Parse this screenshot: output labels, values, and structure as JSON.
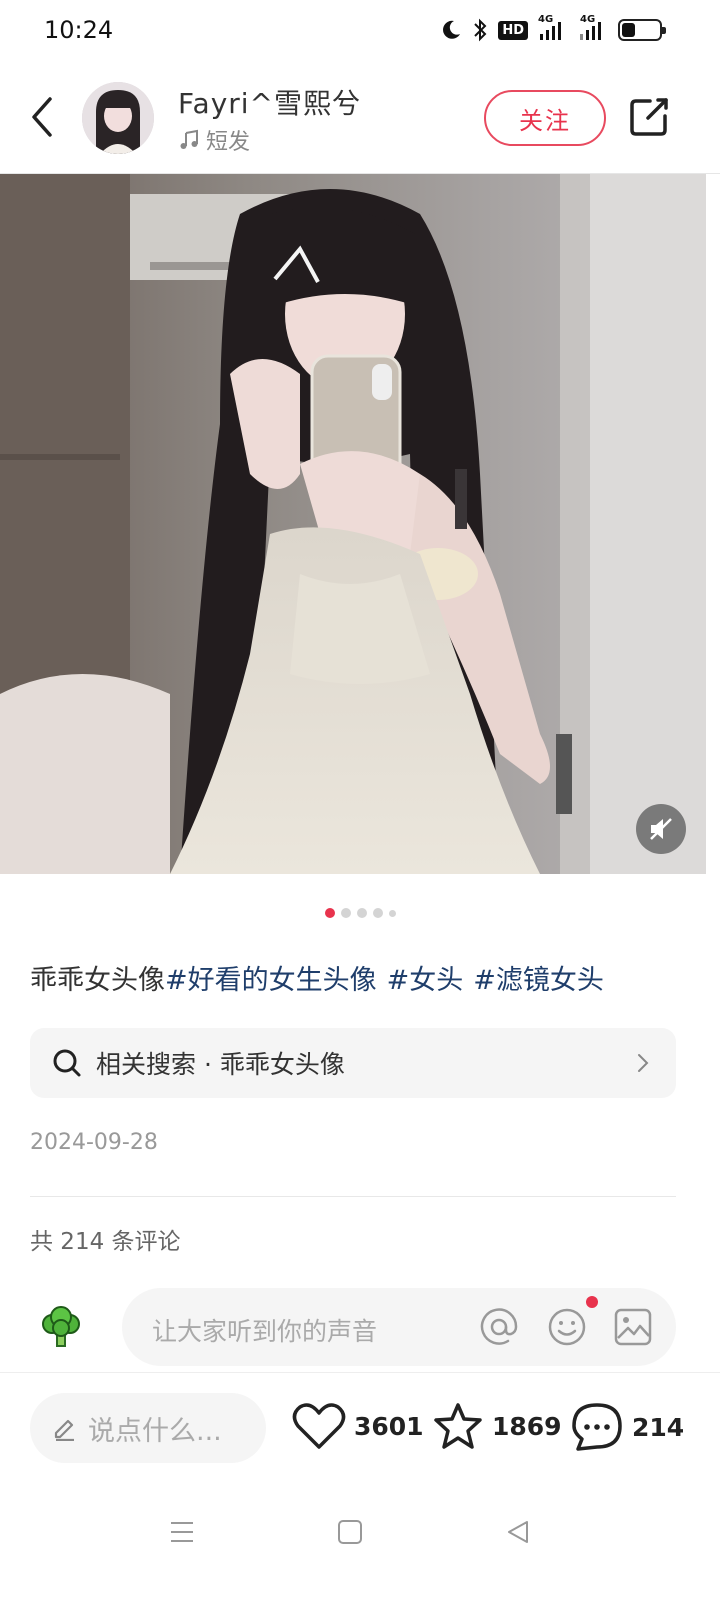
{
  "status_bar": {
    "time": "10:24",
    "hd_badge": "HD",
    "signal_1": "4G",
    "signal_2": "4G",
    "battery_level": 0.35
  },
  "header": {
    "author_name": "Fayri^雪熙兮",
    "music_label": "短发",
    "follow_label": "关注"
  },
  "carousel": {
    "total": 5,
    "active_index": 0
  },
  "post": {
    "text": "乖乖女头像",
    "tags": [
      "#好看的女生头像",
      "#女头",
      "#滤镜女头"
    ],
    "related_search": "相关搜索 · 乖乖女头像",
    "date": "2024-09-28",
    "comment_count_label": "共 214 条评论"
  },
  "comment_input": {
    "placeholder": "让大家听到你的声音"
  },
  "bottom_bar": {
    "say_label": "说点什么...",
    "likes": "3601",
    "stars": "1869",
    "comments": "214"
  },
  "colors": {
    "accent": "#e8334d",
    "tag": "#1f3e6b"
  }
}
